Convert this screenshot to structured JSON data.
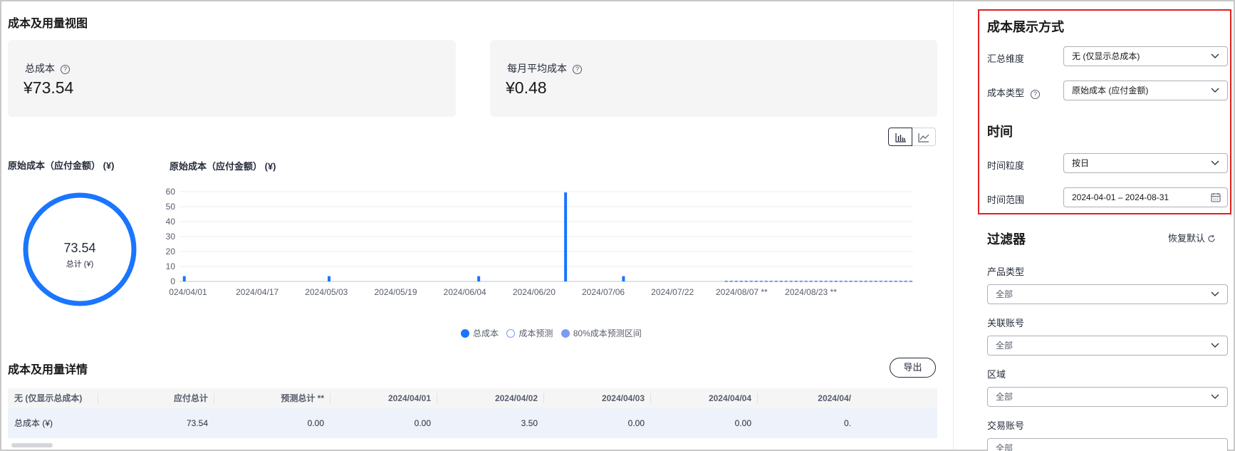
{
  "page_title": "成本及用量视图",
  "summary": {
    "total_label": "总成本",
    "total_value": "¥73.54",
    "monthly_label": "每月平均成本",
    "monthly_value": "¥0.48",
    "help_glyph": "?"
  },
  "donut": {
    "title": "原始成本（应付金额） (¥)",
    "value": "73.54",
    "subtitle": "总计 (¥)",
    "color": "#1a75ff"
  },
  "chart_data": {
    "type": "bar",
    "title": "原始成本（应付金额） (¥)",
    "xlabel": "",
    "ylabel": "",
    "ylim": [
      0,
      60
    ],
    "yticks": [
      "60",
      "50",
      "40",
      "30",
      "20",
      "10",
      "0"
    ],
    "xticks": [
      "024/04/01",
      "2024/04/17",
      "2024/05/03",
      "2024/05/19",
      "2024/06/04",
      "2024/06/20",
      "2024/07/06",
      "2024/07/22",
      "2024/08/07 **",
      "2024/08/23 **"
    ],
    "grid": true,
    "bar_color": "#1a75ff",
    "forecast_color": "#1a75ff",
    "series": [
      {
        "name": "总成本",
        "points": [
          {
            "x": "2024/04/02",
            "y": 3.5
          },
          {
            "x": "2024/05/02",
            "y": 3.5
          },
          {
            "x": "2024/06/02",
            "y": 3.5
          },
          {
            "x": "2024/06/20",
            "y": 59.5
          },
          {
            "x": "2024/07/02",
            "y": 3.5
          }
        ]
      },
      {
        "name": "成本预测",
        "forecast_range": [
          "2024/07/23",
          "2024/08/31"
        ],
        "y": 0.1
      }
    ],
    "legend": [
      {
        "label": "总成本",
        "style": "filled",
        "color": "#1a75ff"
      },
      {
        "label": "成本预测",
        "style": "hollow",
        "color": "#7a9cf0"
      },
      {
        "label": "80%成本预测区间",
        "style": "filled",
        "color": "#7a9cf0"
      }
    ],
    "legend_position": "bottom-center"
  },
  "detail": {
    "title": "成本及用量详情",
    "export_label": "导出",
    "columns": [
      "无 (仅显示总成本)",
      "应付总计",
      "预测总计 **",
      "2024/04/01",
      "2024/04/02",
      "2024/04/03",
      "2024/04/04",
      "2024/04/"
    ],
    "rows": [
      [
        "总成本 (¥)",
        "73.54",
        "0.00",
        "0.00",
        "3.50",
        "0.00",
        "0.00",
        "0."
      ]
    ]
  },
  "panel": {
    "display_title": "成本展示方式",
    "aggregate_label": "汇总维度",
    "aggregate_value": "无 (仅显示总成本)",
    "cost_type_label": "成本类型",
    "cost_type_value": "原始成本 (应付金额)",
    "time_title": "时间",
    "granularity_label": "时间粒度",
    "granularity_value": "按日",
    "range_label": "时间范围",
    "range_value": "2024-04-01 – 2024-08-31",
    "filter_title": "过滤器",
    "reset_label": "恢复默认",
    "filters": [
      {
        "label": "产品类型",
        "value": "全部"
      },
      {
        "label": "关联账号",
        "value": "全部"
      },
      {
        "label": "区域",
        "value": "全部"
      },
      {
        "label": "交易账号",
        "value": "全部"
      }
    ],
    "highlight_color": "#e02020"
  }
}
